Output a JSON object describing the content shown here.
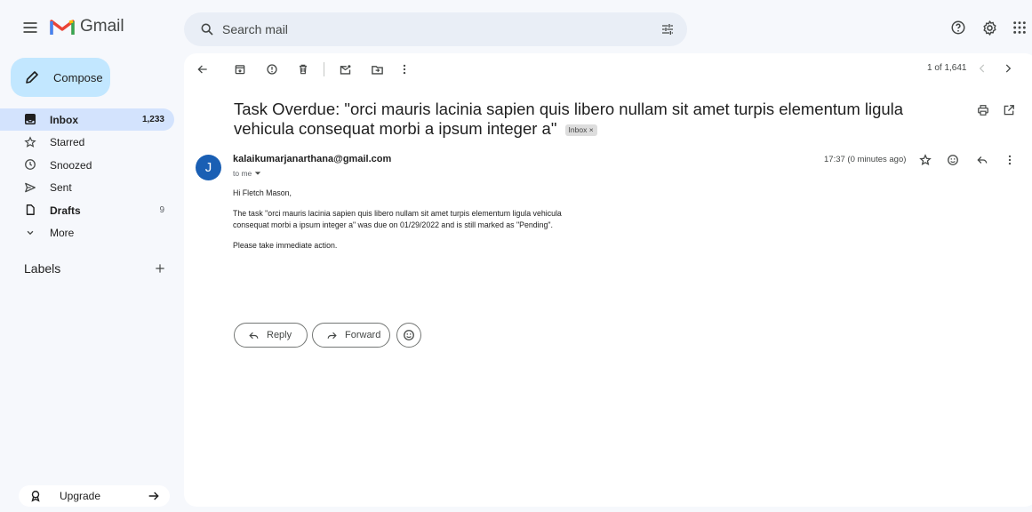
{
  "app": {
    "brand": "Gmail"
  },
  "search": {
    "placeholder": "Search mail"
  },
  "compose": {
    "label": "Compose"
  },
  "nav": {
    "items": [
      {
        "label": "Inbox",
        "count": "1,233"
      },
      {
        "label": "Starred",
        "count": ""
      },
      {
        "label": "Snoozed",
        "count": ""
      },
      {
        "label": "Sent",
        "count": ""
      },
      {
        "label": "Drafts",
        "count": "9"
      },
      {
        "label": "More",
        "count": ""
      }
    ],
    "labels_heading": "Labels",
    "upgrade_label": "Upgrade"
  },
  "toolbar": {
    "pagination": "1 of 1,641"
  },
  "email": {
    "subject": "Task Overdue: \"orci mauris lacinia sapien quis libero nullam sit amet turpis elementum ligula vehicula consequat morbi a ipsum integer a\"",
    "label_chip": "Inbox ×",
    "sender_initial": "J",
    "sender": "kalaikumarjanarthana@gmail.com",
    "recipient": "to me",
    "time": "17:37 (0 minutes ago)",
    "greeting": "Hi Fletch Mason,",
    "body": "The task \"orci mauris lacinia sapien quis libero nullam sit amet turpis elementum ligula vehicula consequat morbi a ipsum integer a\" was due on 01/29/2022 and is still marked as \"Pending\".",
    "action": "Please take immediate action."
  },
  "actions": {
    "reply": "Reply",
    "forward": "Forward"
  },
  "colors": {
    "compose_bg": "#c2e7ff",
    "active_nav": "#d3e3fd",
    "avatar": "#1a5fb4",
    "app_bg": "#f6f8fc"
  }
}
